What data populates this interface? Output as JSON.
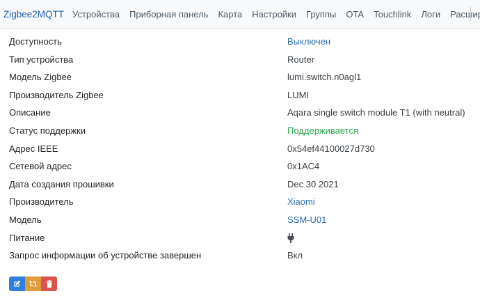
{
  "nav": {
    "brand": "Zigbee2MQTT",
    "items": [
      "Устройства",
      "Приборная панель",
      "Карта",
      "Настройки",
      "Группы",
      "OTA",
      "Touchlink",
      "Логи",
      "Расширения"
    ],
    "language_flag": "russia-flag-icon"
  },
  "rows": [
    {
      "label": "Доступность",
      "value": "Выключен",
      "style": "link"
    },
    {
      "label": "Тип устройства",
      "value": "Router",
      "style": "plain"
    },
    {
      "label": "Модель Zigbee",
      "value": "lumi.switch.n0agl1",
      "style": "plain"
    },
    {
      "label": "Производитель Zigbee",
      "value": "LUMI",
      "style": "plain"
    },
    {
      "label": "Описание",
      "value": "Aqara single switch module T1 (with neutral)",
      "style": "plain"
    },
    {
      "label": "Статус поддержки",
      "value": "Поддерживается",
      "style": "ok"
    },
    {
      "label": "Адрес IEEE",
      "value": "0x54ef44100027d730",
      "style": "plain"
    },
    {
      "label": "Сетевой адрес",
      "value": "0x1AC4",
      "style": "plain"
    },
    {
      "label": "Дата создания прошивки",
      "value": "Dec 30 2021",
      "style": "plain"
    },
    {
      "label": "Производитель",
      "value": "Xiaomi",
      "style": "link"
    },
    {
      "label": "Модель",
      "value": "SSM-U01",
      "style": "link"
    },
    {
      "label": "Питание",
      "value": "",
      "icon": "plug-icon",
      "style": "plain"
    },
    {
      "label": "Запрос информации об устройстве завершен",
      "value": "Вкл",
      "style": "plain"
    }
  ],
  "actions": [
    {
      "name": "edit-button",
      "icon": "edit-icon",
      "color": "#2f7fe0"
    },
    {
      "name": "rename-button",
      "icon": "swap-icon",
      "color": "#e09b3a"
    },
    {
      "name": "delete-button",
      "icon": "trash-icon",
      "color": "#d9534f"
    }
  ]
}
